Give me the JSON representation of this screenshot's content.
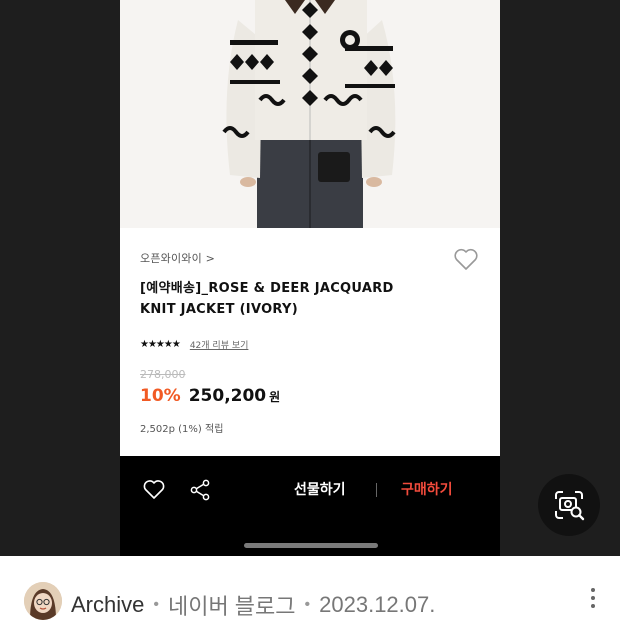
{
  "product": {
    "brand": "오픈와이와이 >",
    "title_line1": "[예약배송]_ROSE & DEER JACQUARD",
    "title_line2": "KNIT JACKET (IVORY)",
    "rating_stars": "★★★★★",
    "reviews_link": "42개 리뷰 보기",
    "original_price": "278,000",
    "discount": "10%",
    "sale_price": "250,200",
    "currency": "원",
    "points": "2,502p (1%) 적립",
    "rating": 4.5
  },
  "action_bar": {
    "gift_label": "선물하기",
    "buy_label": "구매하기",
    "buy_color": "#f24b3c"
  },
  "icons": {
    "like": "heart-outline-icon",
    "share": "share-icon",
    "lens": "image-search-icon",
    "more": "more-vertical-icon"
  },
  "footer": {
    "author": "Archive",
    "blog": "네이버 블로그",
    "date": "2023.12.07."
  },
  "colors": {
    "discount": "#f15a24",
    "viewer_bg": "#1e1e1e"
  }
}
